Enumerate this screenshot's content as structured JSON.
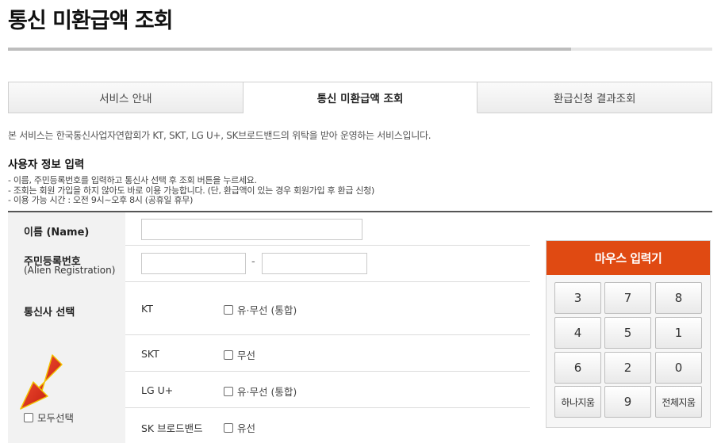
{
  "page": {
    "title": "통신 미환급액 조회"
  },
  "progress": {
    "fraction": 0.8
  },
  "tabs": [
    {
      "label": "서비스 안내",
      "active": false
    },
    {
      "label": "통신 미환급액 조회",
      "active": true
    },
    {
      "label": "환급신청 결과조회",
      "active": false
    }
  ],
  "service_desc": "본 서비스는 한국통신사업자연합회가 KT, SKT, LG U+, SK브로드밴드의 위탁을 받아 운영하는 서비스입니다.",
  "section": {
    "title": "사용자 정보 입력",
    "notes": [
      "- 이름, 주민등록번호를 입력하고 통신사 선택 후 조회 버튼을 누르세요.",
      "- 조회는 회원 가입을 하지 않아도 바로 이용 가능합니다. (단, 환급액이 있는 경우 회원가입 후 환급 신청)",
      "- 이용 가능 시간 : 오전 9시~오후 8시 (공휴일 휴무)"
    ]
  },
  "form": {
    "name_label": "이름 (Name)",
    "name_value": "",
    "reg_label": "주민등록번호",
    "reg_sublabel": "(Alien Registration)",
    "reg_part1": "",
    "reg_part2": "",
    "reg_separator": "-",
    "carrier_label": "통신사 선택",
    "select_all_label": "모두선택",
    "carriers": [
      {
        "name": "KT",
        "option": "유·무선 (통합)"
      },
      {
        "name": "SKT",
        "option": "무선"
      },
      {
        "name": "LG U+",
        "option": "유·무선 (통합)"
      },
      {
        "name": "SK 브로드밴드",
        "option": "유선"
      }
    ]
  },
  "keypad": {
    "title": "마우스 입력기",
    "keys": [
      "3",
      "7",
      "8",
      "4",
      "5",
      "1",
      "6",
      "2",
      "0",
      "하나지움",
      "9",
      "전체지움"
    ]
  },
  "colors": {
    "keypad_header": "#e04a12",
    "arrow": "#d81f0e",
    "form_label_bg": "#f2f2f2"
  }
}
